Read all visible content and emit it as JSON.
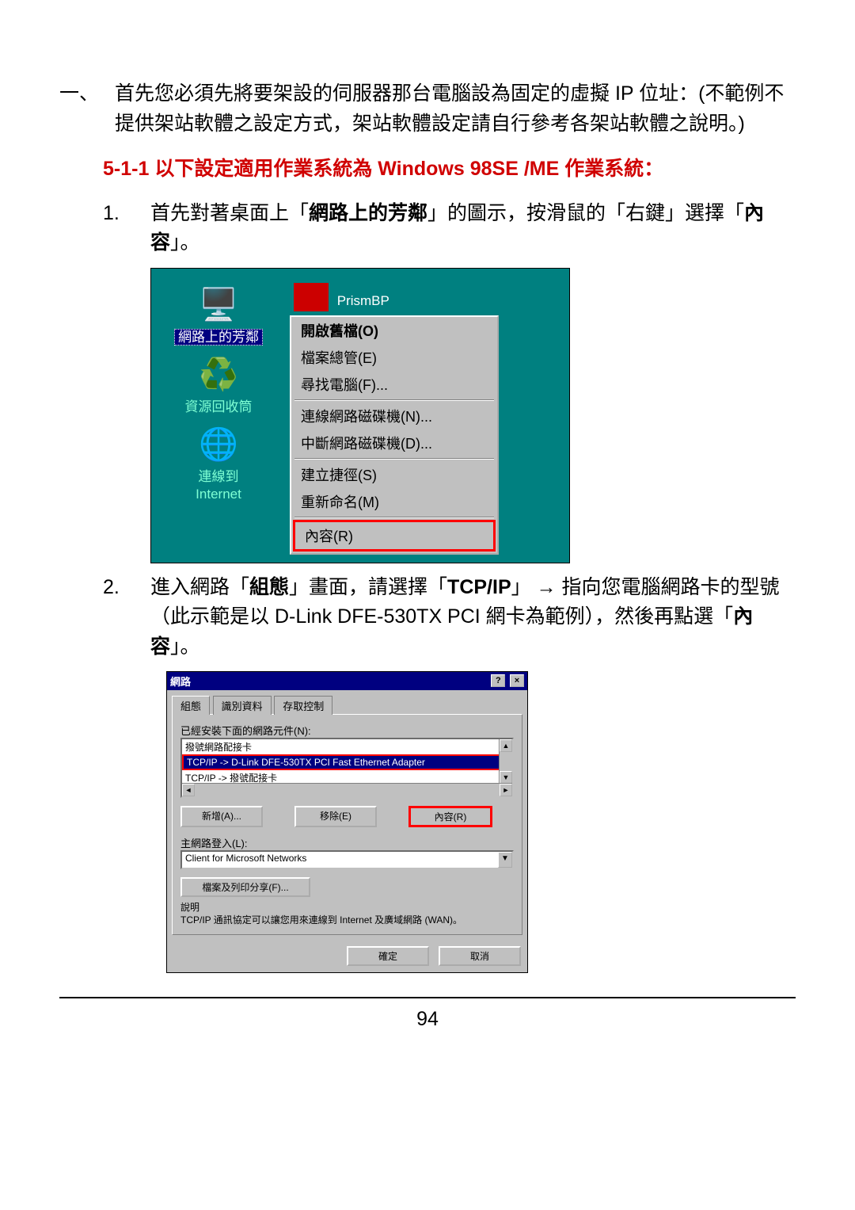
{
  "main_item": {
    "marker": "一、",
    "text": "首先您必須先將要架設的伺服器那台電腦設為固定的虛擬 IP 位址：(不範例不提供架站軟體之設定方式，架站軟體設定請自行參考各架站軟體之說明。)"
  },
  "section": {
    "number": "5-1-1",
    "rest": " 以下設定適用作業系統為 ",
    "os": "Windows 98SE /ME",
    "tail": " 作業系統："
  },
  "step1": {
    "num": "1.",
    "pre": "首先對著桌面上「",
    "bold": "網路上的芳鄰",
    "mid": "」的圖示，按滑鼠的「右鍵」選擇「",
    "bold2": "內容",
    "post": "」。"
  },
  "shot1": {
    "icons": {
      "neighborhood": "網路上的芳鄰",
      "recycle": "資源回收筒",
      "connectto": "連線到",
      "internet": "Internet",
      "prism": "PrismBP"
    },
    "menu": {
      "open": "開啟舊檔(O)",
      "explorer": "檔案總管(E)",
      "find": "尋找電腦(F)...",
      "map": "連線網路磁碟機(N)...",
      "unmap": "中斷網路磁碟機(D)...",
      "shortcut": "建立捷徑(S)",
      "rename": "重新命名(M)",
      "props": "內容(R)"
    }
  },
  "step2": {
    "num": "2.",
    "pre": "進入網路「",
    "bold1": "組態",
    "mid1": "」畫面，請選擇「",
    "bold2": "TCP/IP",
    "mid2": "」 → 指向您電腦網路卡的型號（此示範是以 D-Link DFE-530TX PCI 網卡為範例），然後再點選「",
    "bold3": "內容",
    "post": "」。"
  },
  "shot2": {
    "title": "網路",
    "tabs": {
      "config": "組態",
      "ident": "識別資料",
      "access": "存取控制"
    },
    "installed_label": "已經安裝下面的網路元件(N):",
    "rows": {
      "r1": "撥號網路配接卡",
      "r2": "TCP/IP -> D-Link DFE-530TX PCI Fast Ethernet Adapter",
      "r3": "TCP/IP -> 撥號配接卡"
    },
    "buttons": {
      "add": "新增(A)...",
      "remove": "移除(E)",
      "props": "內容(R)"
    },
    "primary_label": "主網路登入(L):",
    "primary_value": "Client for Microsoft Networks",
    "share_btn": "檔案及列印分享(F)...",
    "desc_label": "說明",
    "desc_text": "TCP/IP 通訊協定可以讓您用來連線到 Internet 及廣域網路 (WAN)。",
    "ok": "確定",
    "cancel": "取消"
  },
  "page_number": "94"
}
